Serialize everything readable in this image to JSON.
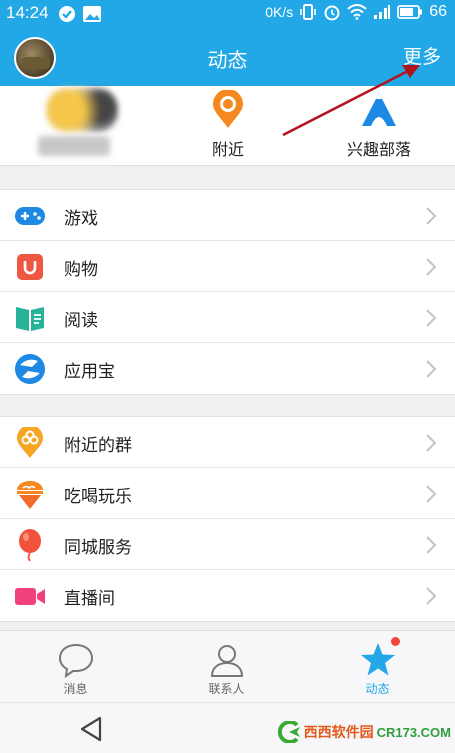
{
  "status_bar": {
    "time": "14:24",
    "network_speed": "0K/s",
    "battery": "66"
  },
  "header": {
    "title": "动态",
    "more_label": "更多"
  },
  "quick_access": [
    {
      "label": "",
      "icon": "blurred-user-icon"
    },
    {
      "label": "附近",
      "icon": "location-pin-icon"
    },
    {
      "label": "兴趣部落",
      "icon": "tribe-icon"
    }
  ],
  "groups": [
    {
      "items": [
        {
          "label": "游戏",
          "icon": "gamepad-icon"
        },
        {
          "label": "购物",
          "icon": "shopping-bag-icon"
        },
        {
          "label": "阅读",
          "icon": "book-icon"
        },
        {
          "label": "应用宝",
          "icon": "app-store-icon"
        }
      ]
    },
    {
      "items": [
        {
          "label": "附近的群",
          "icon": "nearby-group-icon"
        },
        {
          "label": "吃喝玩乐",
          "icon": "food-icon"
        },
        {
          "label": "同城服务",
          "icon": "balloon-icon"
        },
        {
          "label": "直播间",
          "icon": "video-camera-icon"
        }
      ]
    }
  ],
  "tabs": [
    {
      "label": "消息",
      "icon": "chat-bubble-icon"
    },
    {
      "label": "联系人",
      "icon": "contacts-icon"
    },
    {
      "label": "动态",
      "icon": "star-icon",
      "active": true
    }
  ],
  "watermark": {
    "brand": "西西软件园",
    "site": "CR173.COM"
  },
  "colors": {
    "primary": "#22a8e6",
    "badge": "#f2443b"
  }
}
